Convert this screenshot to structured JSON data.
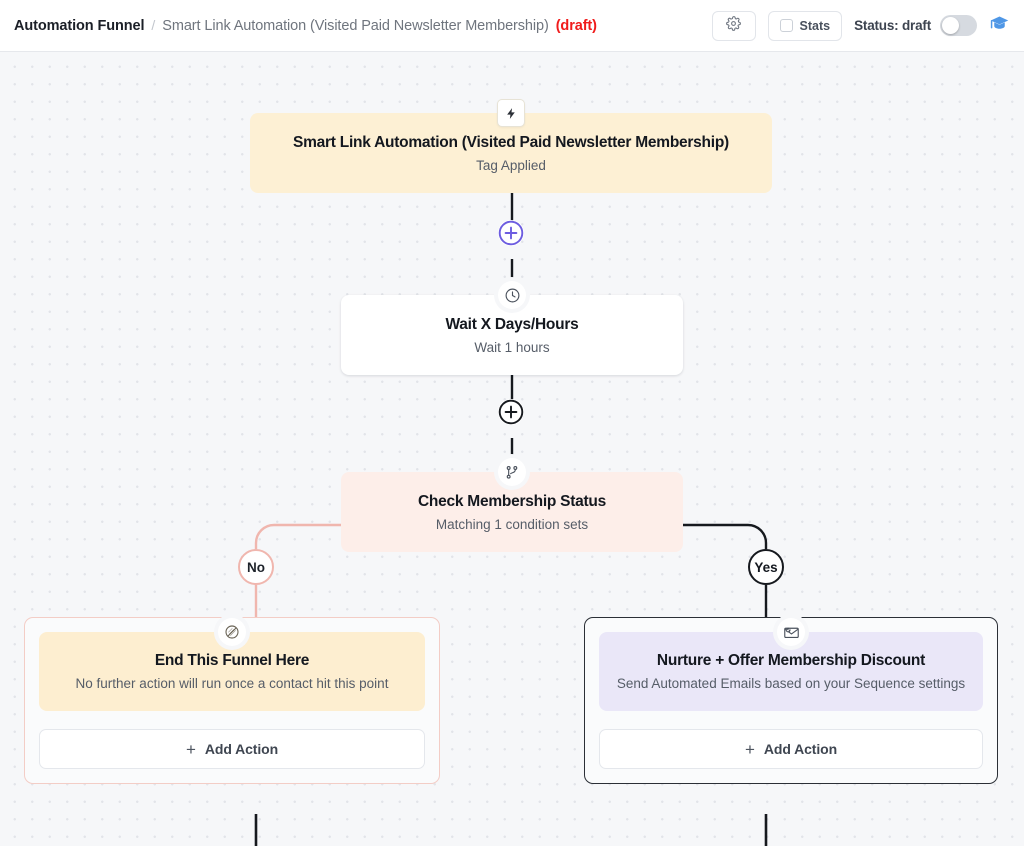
{
  "header": {
    "breadcrumb_root": "Automation Funnel",
    "breadcrumb_separator": "/",
    "breadcrumb_current": "Smart Link Automation (Visited Paid Newsletter Membership)",
    "breadcrumb_state": "(draft)",
    "settings_icon": "gear-icon",
    "stats_label": "Stats",
    "stats_checked": false,
    "status_label": "Status: draft",
    "status_toggle_on": false,
    "help_icon": "graduation-cap-icon",
    "help_icon_color": "#4f97e6",
    "draft_color": "#f01b1b"
  },
  "flow": {
    "trigger": {
      "icon": "lightning-bolt-icon",
      "title": "Smart Link Automation (Visited Paid Newsletter Membership)",
      "subtitle": "Tag Applied",
      "color": "#fdf0d4"
    },
    "add_buttons": [
      {
        "name": "add-step-button-1",
        "label": "+",
        "color": "#6c5ce0"
      },
      {
        "name": "add-step-button-2",
        "label": "+",
        "color": "#16191e"
      }
    ],
    "wait": {
      "icon": "clock-icon",
      "title": "Wait X Days/Hours",
      "subtitle": "Wait 1 hours",
      "color": "#ffffff"
    },
    "condition": {
      "icon": "branch-split-icon",
      "title": "Check Membership Status",
      "subtitle": "Matching 1 condition sets",
      "color": "#fdeee9"
    },
    "branches": [
      {
        "pill_label": "No",
        "pill_color": "#f0b6ae",
        "wire_color": "#f0b6ae",
        "card": {
          "icon": "no-entry-icon",
          "title": "End This Funnel Here",
          "subtitle": "No further action will run once a contact hit this point",
          "color": "#fdeed0"
        },
        "add_action_label": "Add Action",
        "add_action_plus": "+"
      },
      {
        "pill_label": "Yes",
        "pill_color": "#16191e",
        "wire_color": "#16191e",
        "card": {
          "icon": "email-check-icon",
          "title": "Nurture + Offer Membership Discount",
          "subtitle": "Send Automated Emails based on your Sequence settings",
          "color": "#eae7f8"
        },
        "add_action_label": "Add Action",
        "add_action_plus": "+"
      }
    ]
  }
}
